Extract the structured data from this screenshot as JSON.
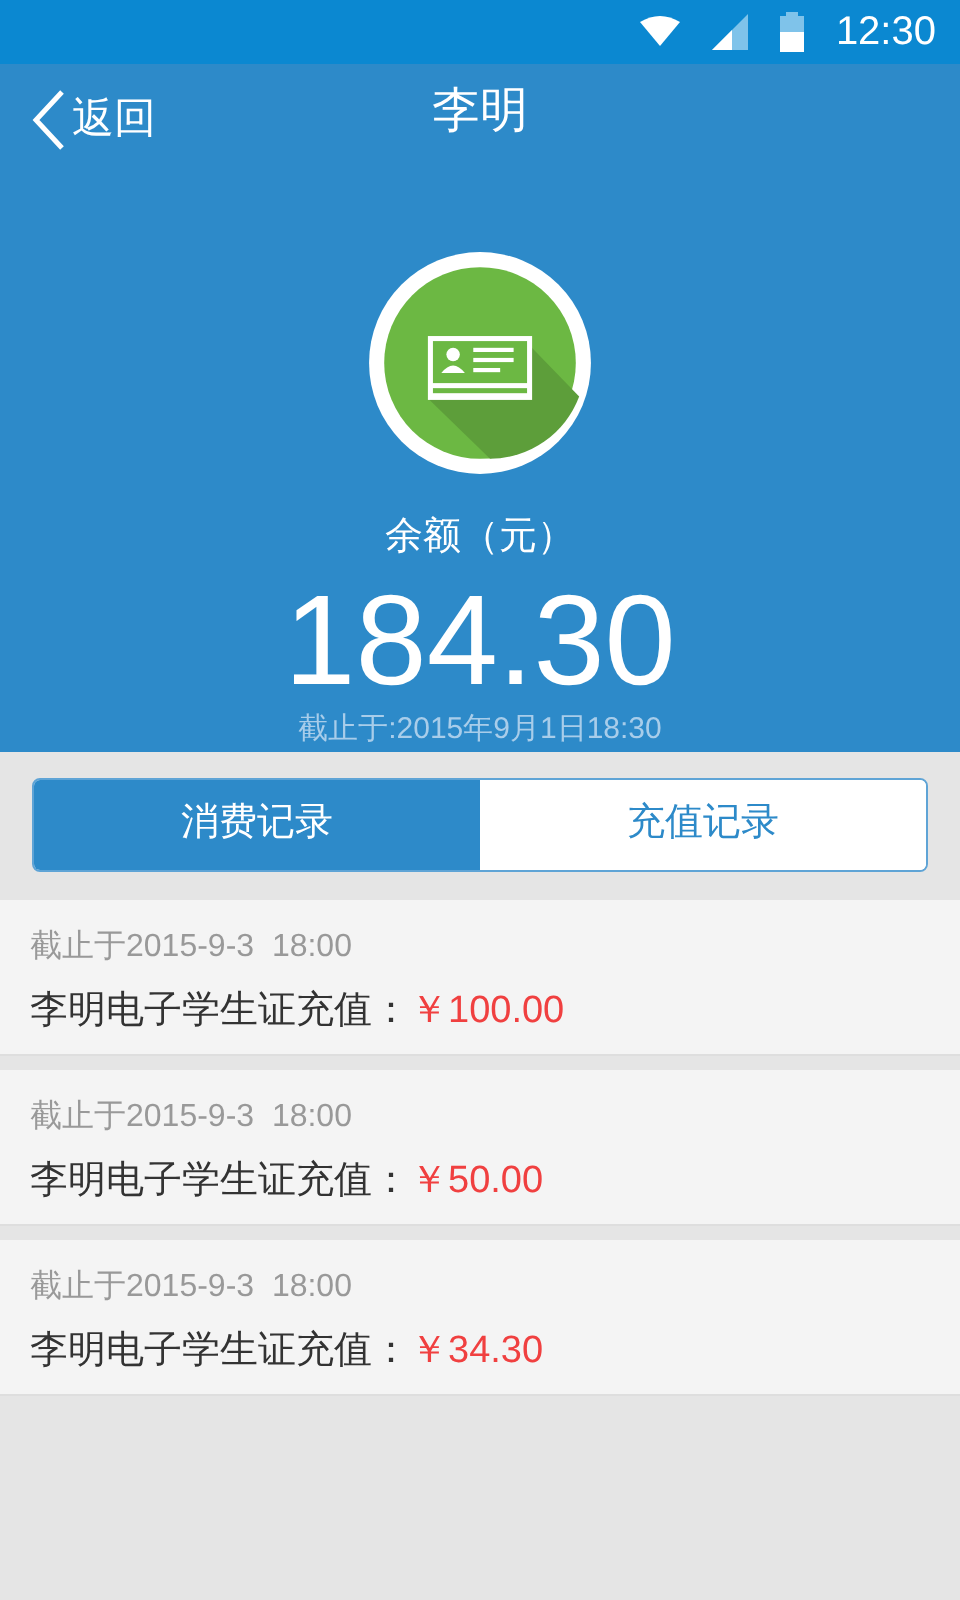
{
  "status_bar": {
    "time": "12:30"
  },
  "header": {
    "back": "返回",
    "title": "李明"
  },
  "balance": {
    "label": "余额（元）",
    "amount": "184.30",
    "as_of": "截止于:2015年9月1日18:30"
  },
  "tabs": [
    {
      "label": "消费记录",
      "selected": true
    },
    {
      "label": "充值记录",
      "selected": false
    }
  ],
  "records": [
    {
      "date": "截止于2015-9-3  18:00",
      "label": "李明电子学生证充值：",
      "amount": "￥100.00"
    },
    {
      "date": "截止于2015-9-3  18:00",
      "label": "李明电子学生证充值：",
      "amount": "￥50.00"
    },
    {
      "date": "截止于2015-9-3  18:00",
      "label": "李明电子学生证充值：",
      "amount": "￥34.30"
    }
  ]
}
